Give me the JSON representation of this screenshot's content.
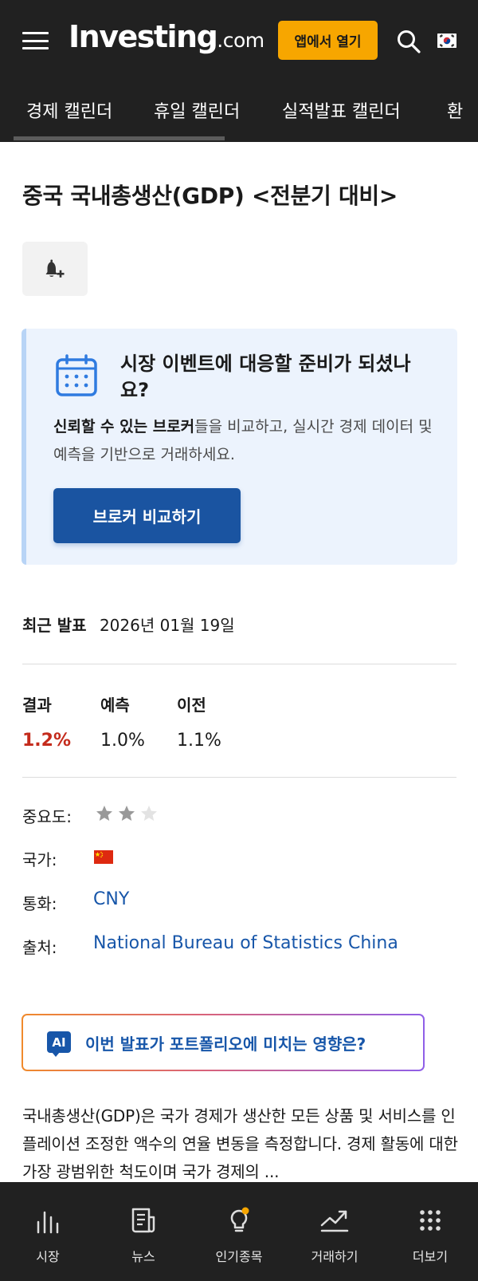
{
  "header": {
    "logo_main": "Investing",
    "logo_suffix": ".com",
    "open_app_label": "앱에서 열기",
    "tabs": [
      {
        "label": "경제 캘린더"
      },
      {
        "label": "휴일 캘린더"
      },
      {
        "label": "실적발표 캘린더"
      },
      {
        "label": "환"
      }
    ]
  },
  "page": {
    "title": "중국 국내총생산(GDP) <전분기 대비>"
  },
  "promo": {
    "title": "시장 이벤트에 대응할 준비가 되셨나요?",
    "body_bold": "신뢰할 수 있는 브로커",
    "body_rest": "들을 비교하고, 실시간 경제 데이터 및 예측을 기반으로 거래하세요.",
    "button_label": "브로커 비교하기"
  },
  "release": {
    "label": "최근 발표",
    "date": "2026년 01월 19일"
  },
  "stats": {
    "actual_label": "결과",
    "forecast_label": "예측",
    "previous_label": "이전",
    "actual": "1.2%",
    "forecast": "1.0%",
    "previous": "1.1%"
  },
  "meta": {
    "importance_label": "중요도:",
    "importance_stars": 2,
    "importance_max": 3,
    "country_label": "국가:",
    "country_flag": "china-flag-icon",
    "currency_label": "통화:",
    "currency": "CNY",
    "source_label": "출처:",
    "source": "National Bureau of Statistics China"
  },
  "ai": {
    "badge": "AI",
    "prompt": "이번 발표가 포트폴리오에 미치는 영향은?"
  },
  "description": "국내총생산(GDP)은 국가 경제가 생산한 모든 상품 및 서비스를 인플레이션 조정한 액수의 연율 변동을 측정합니다. 경제 활동에 대한 가장 광범위한 척도이며 국가 경제의 ...",
  "bottom_nav": [
    {
      "label": "시장",
      "icon": "bar-chart-icon"
    },
    {
      "label": "뉴스",
      "icon": "newspaper-icon"
    },
    {
      "label": "인기종목",
      "icon": "lightbulb-icon"
    },
    {
      "label": "거래하기",
      "icon": "trend-up-icon"
    },
    {
      "label": "더보기",
      "icon": "grid-dots-icon"
    }
  ],
  "colors": {
    "header_bg": "#212121",
    "accent_orange": "#f7a600",
    "link_blue": "#1756a9",
    "button_blue": "#1a54a1",
    "actual_red": "#c42b1c",
    "promo_bg": "#ecf3fd"
  }
}
